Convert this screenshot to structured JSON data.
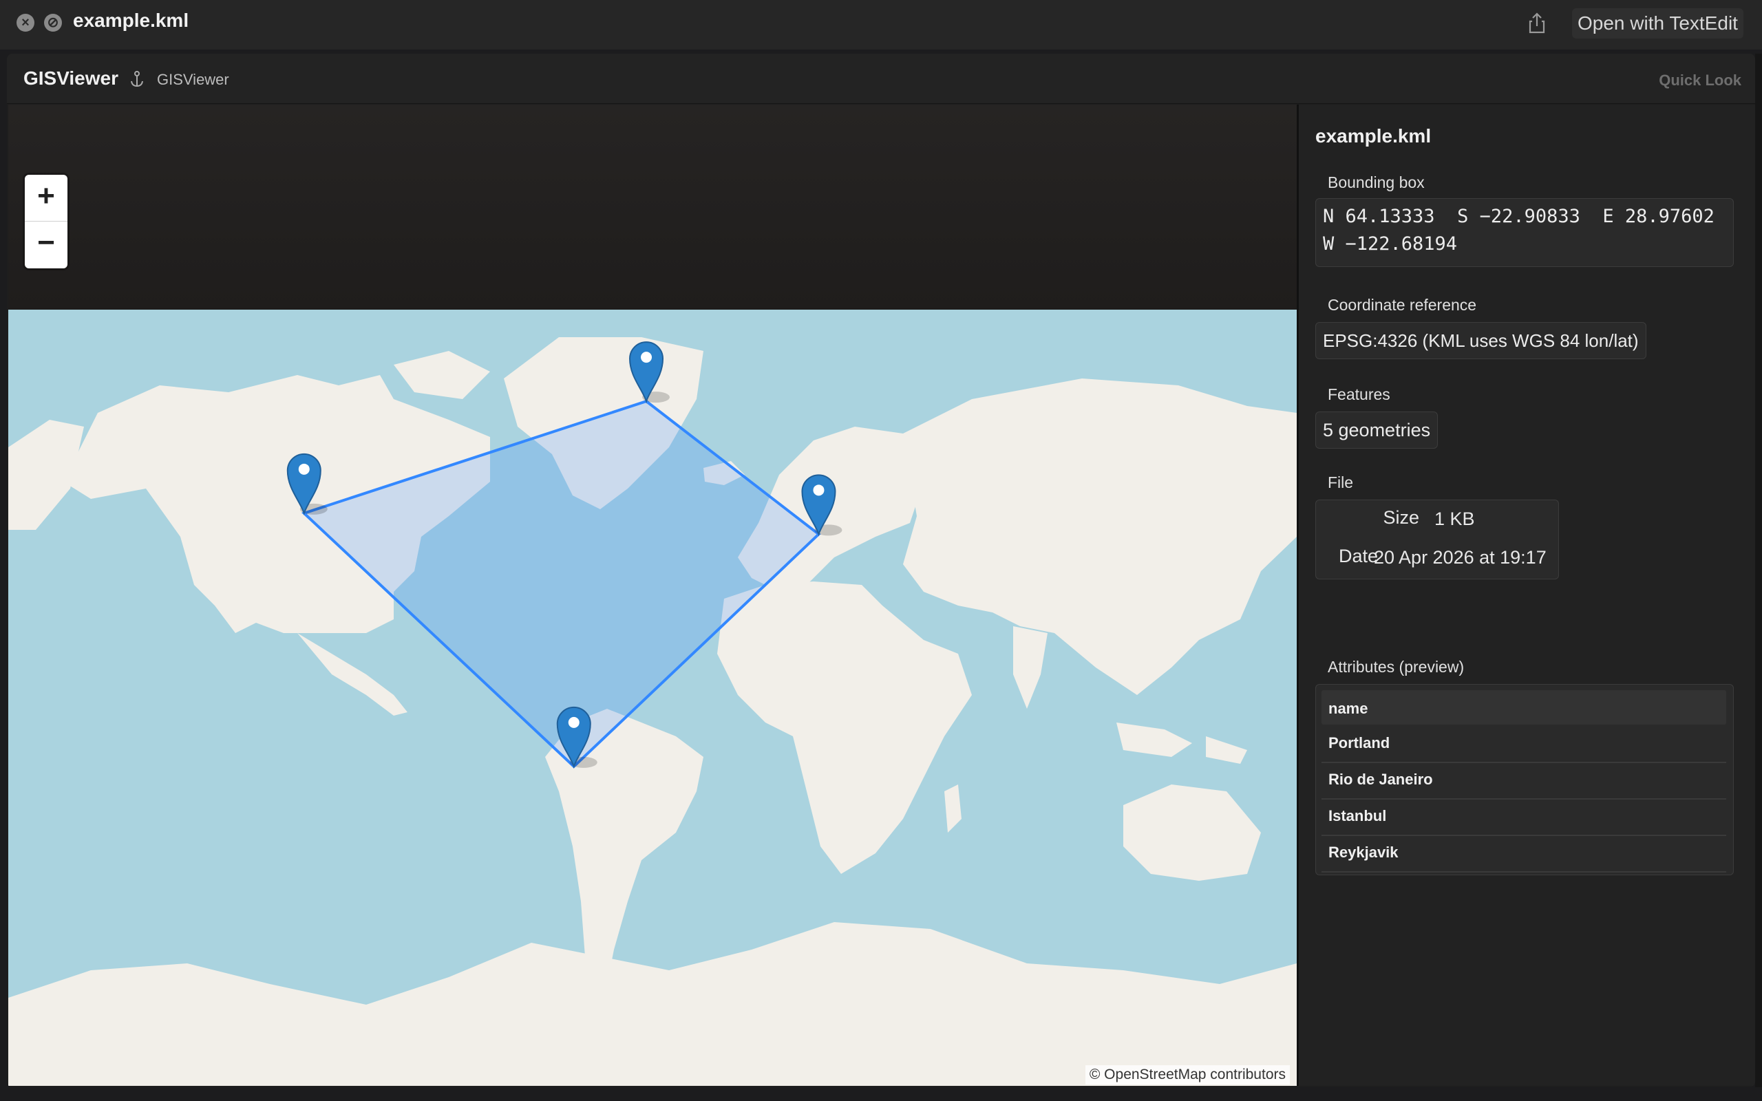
{
  "quicklook": {
    "title": "example.kml",
    "open_with_label": "Open with TextEdit",
    "icons": [
      "close-icon",
      "fullscreen-icon",
      "share-icon"
    ]
  },
  "app": {
    "name": "GISViewer",
    "subtitle": "GISViewer",
    "quick_look_label": "Quick Look"
  },
  "map": {
    "zoom_in_label": "+",
    "zoom_out_label": "−",
    "attribution": "© OpenStreetMap contributors",
    "markers": [
      {
        "name": "Portland",
        "lat": 45.52,
        "lon": -122.68
      },
      {
        "name": "Rio de Janeiro",
        "lat": -22.91,
        "lon": -43.17
      },
      {
        "name": "Istanbul",
        "lat": 41.01,
        "lon": 28.98
      },
      {
        "name": "Reykjavik",
        "lat": 64.13,
        "lon": -21.82
      }
    ],
    "colors": {
      "water": "#aad3df",
      "land": "#f2efe9",
      "polygon": "#3388ff",
      "marker": "#2a81cb"
    }
  },
  "panel": {
    "title": "example.kml",
    "bbox_label": "Bounding box",
    "bbox_line1": "N 64.13333  S −22.90833  E 28.97602",
    "bbox_line2": "W −122.68194",
    "crs_label": "Coordinate reference",
    "crs_value": "EPSG:4326 (KML uses WGS 84 lon/lat)",
    "features_label": "Features",
    "features_value": "5 geometries",
    "file_label": "File",
    "size_key": "Size",
    "size_value": "1 KB",
    "date_key": "Date",
    "date_value": "20 Apr 2026 at 19:17",
    "attributes_label": "Attributes (preview)",
    "attributes_column": "name",
    "attributes_rows": [
      "Portland",
      "Rio de Janeiro",
      "Istanbul",
      "Reykjavik"
    ]
  }
}
